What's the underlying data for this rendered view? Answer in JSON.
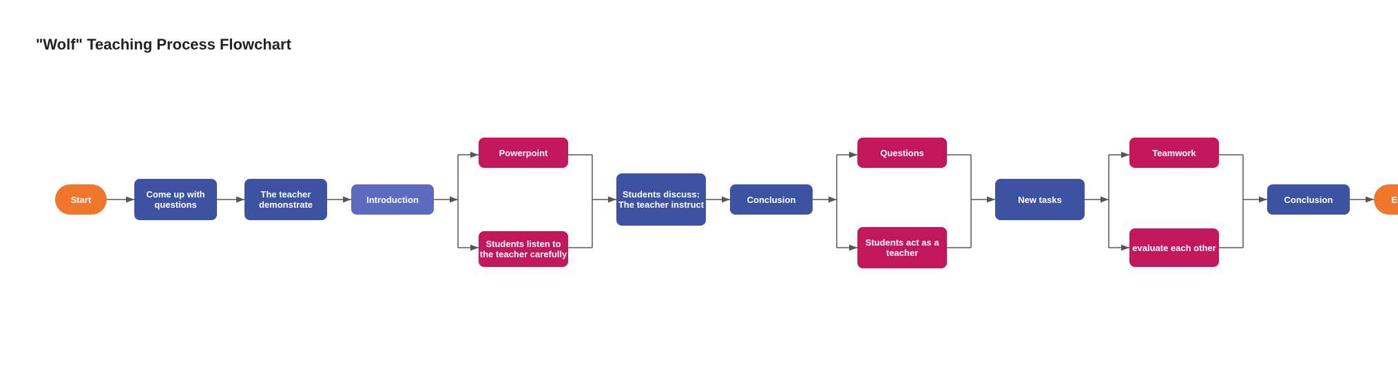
{
  "title": "\"Wolf\" Teaching Process Flowchart",
  "nodes": {
    "start": {
      "label": "Start"
    },
    "come_with_questions": {
      "label": "Come up with questions"
    },
    "teacher_demonstrate": {
      "label": "The teacher demonstrate"
    },
    "introduction": {
      "label": "Introduction"
    },
    "powerpoint": {
      "label": "Powerpoint"
    },
    "students_listen": {
      "label": "Students listen to the teacher carefully"
    },
    "students_discuss": {
      "label": "Students discuss: The teacher instruct"
    },
    "conclusion1": {
      "label": "Conclusion"
    },
    "questions": {
      "label": "Questions"
    },
    "students_act": {
      "label": "Students act as a teacher"
    },
    "new_tasks": {
      "label": "New tasks"
    },
    "teamwork": {
      "label": "Teamwork"
    },
    "evaluate_each_other": {
      "label": "evaluate each other"
    },
    "conclusion2": {
      "label": "Conclusion"
    },
    "end": {
      "label": "End"
    }
  }
}
